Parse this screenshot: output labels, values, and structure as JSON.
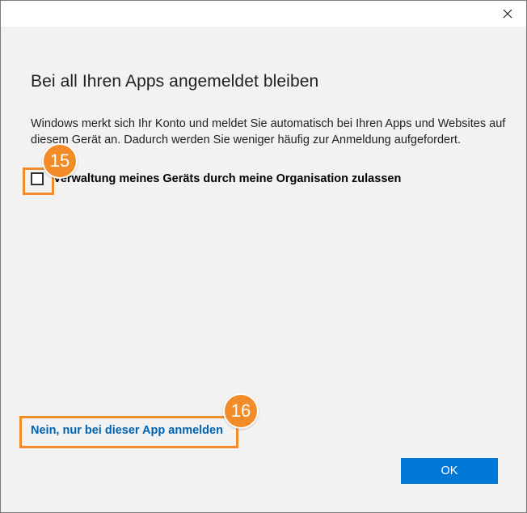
{
  "window": {
    "close_icon": "close-icon"
  },
  "dialog": {
    "heading": "Bei all Ihren Apps angemeldet bleiben",
    "description": "Windows merkt sich Ihr Konto und meldet Sie automatisch bei Ihren Apps und Websites auf diesem Gerät an. Dadurch werden Sie weniger häufig zur Anmeldung aufgefordert.",
    "checkbox": {
      "label": "Verwaltung meines Geräts durch meine Organisation zulassen",
      "checked": false
    },
    "link_text": "Nein, nur bei dieser App anmelden",
    "ok_label": "OK"
  },
  "annotations": {
    "callout_checkbox": "15",
    "callout_link": "16",
    "color": "#f28c28"
  },
  "colors": {
    "accent": "#0078d7",
    "link": "#0063b1",
    "background": "#f2f2f2"
  }
}
